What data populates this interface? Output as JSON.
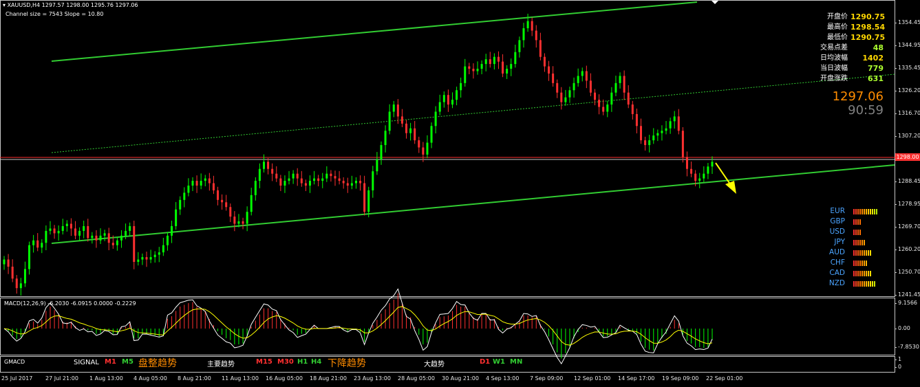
{
  "header": {
    "symbol_line": "XAUUSD,H4  1297.57 1298.00 1295.76 1297.06",
    "channel_line": "Channel size = 7543 Slope = 10.80"
  },
  "stats": [
    {
      "label": "开盘价",
      "value": "1290.75",
      "tone": "gold"
    },
    {
      "label": "最高价",
      "value": "1298.54",
      "tone": "gold"
    },
    {
      "label": "最低价",
      "value": "1290.75",
      "tone": "gold"
    },
    {
      "label": "交易点差",
      "value": "48",
      "tone": "green"
    },
    {
      "label": "日均波幅",
      "value": "1402",
      "tone": "gold"
    },
    {
      "label": "当日波幅",
      "value": "779",
      "tone": "green"
    },
    {
      "label": "开盘涨跌",
      "value": "631",
      "tone": "green"
    }
  ],
  "big_price": "1297.06",
  "big_timer": "90:59",
  "current_price_tag": "1298.00",
  "currency_strength": [
    {
      "name": "EUR",
      "bars": 12
    },
    {
      "name": "GBP",
      "bars": 4
    },
    {
      "name": "USD",
      "bars": 4
    },
    {
      "name": "JPY",
      "bars": 6
    },
    {
      "name": "AUD",
      "bars": 9
    },
    {
      "name": "CHF",
      "bars": 7
    },
    {
      "name": "CAD",
      "bars": 9
    },
    {
      "name": "NZD",
      "bars": 11
    }
  ],
  "price_scale": [
    "1354.45",
    "1344.95",
    "1335.45",
    "1326.20",
    "1316.70",
    "1307.20",
    "1297.70",
    "1288.45",
    "1278.95",
    "1269.70",
    "1260.20",
    "1250.70",
    "1241.45"
  ],
  "macd": {
    "label": "MACD(12,26,9) -6.2030 -6.0915 0.0000 -0.2229",
    "scale": [
      "9.1566",
      "0.00",
      "-7.8530"
    ]
  },
  "gmacd": {
    "label": "GMACD",
    "scale": [
      "1",
      "0"
    ],
    "signal_label": "SIGNAL",
    "signals": [
      {
        "text": "M1",
        "tone": "red"
      },
      {
        "text": "M5",
        "tone": "green"
      },
      {
        "text": "盘整趋势",
        "tone": "orange"
      },
      {
        "text": "主要趋势",
        "tone": "white"
      },
      {
        "text": "M15",
        "tone": "red"
      },
      {
        "text": "M30",
        "tone": "red"
      },
      {
        "text": "H1",
        "tone": "green"
      },
      {
        "text": "H4",
        "tone": "green"
      },
      {
        "text": "下降趋势",
        "tone": "orange"
      },
      {
        "text": "大趋势",
        "tone": "white"
      },
      {
        "text": "D1",
        "tone": "red"
      },
      {
        "text": "W1",
        "tone": "green"
      },
      {
        "text": "MN",
        "tone": "green"
      }
    ]
  },
  "time_axis": [
    "25 Jul 2017",
    "27 Jul 21:00",
    "1 Aug 13:00",
    "4 Aug 05:00",
    "8 Aug 21:00",
    "11 Aug 13:00",
    "16 Aug 05:00",
    "18 Aug 21:00",
    "23 Aug 13:00",
    "28 Aug 05:00",
    "30 Aug 21:00",
    "4 Sep 13:00",
    "7 Sep 09:00",
    "12 Sep 01:00",
    "14 Sep 17:00",
    "19 Sep 09:00",
    "22 Sep 01:00"
  ],
  "colors": {
    "bull": "#00ff00",
    "bear": "#ff3030",
    "channel": "#32cd32",
    "bid_line": "#ff3030",
    "arrow": "#ffff00"
  },
  "chart_data": {
    "type": "candlestick",
    "ylim": [
      1241.45,
      1358.5
    ],
    "closes": [
      1256,
      1253,
      1248,
      1244,
      1246,
      1252,
      1262,
      1264,
      1261,
      1263,
      1268,
      1269,
      1267,
      1268,
      1270,
      1271,
      1269,
      1266,
      1268,
      1270,
      1265,
      1266,
      1264,
      1266,
      1267,
      1263,
      1262,
      1264,
      1266,
      1268,
      1270,
      1255,
      1256,
      1257,
      1256,
      1257,
      1258,
      1259,
      1262,
      1266,
      1270,
      1277,
      1281,
      1284,
      1287,
      1289,
      1287,
      1289,
      1290,
      1288,
      1285,
      1281,
      1280,
      1278,
      1274,
      1271,
      1272,
      1271,
      1276,
      1283,
      1289,
      1294,
      1297,
      1294,
      1292,
      1290,
      1287,
      1289,
      1290,
      1292,
      1290,
      1288,
      1287,
      1289,
      1290,
      1289,
      1290,
      1292,
      1291,
      1290,
      1289,
      1288,
      1287,
      1288,
      1289,
      1288,
      1276,
      1285,
      1293,
      1298,
      1304,
      1310,
      1318,
      1321,
      1316,
      1313,
      1309,
      1311,
      1306,
      1303,
      1300,
      1305,
      1312,
      1318,
      1322,
      1325,
      1321,
      1323,
      1327,
      1330,
      1337,
      1336,
      1335,
      1336,
      1338,
      1340,
      1338,
      1341,
      1339,
      1334,
      1336,
      1338,
      1343,
      1348,
      1353,
      1356,
      1352,
      1348,
      1341,
      1337,
      1334,
      1330,
      1326,
      1322,
      1324,
      1327,
      1330,
      1333,
      1335,
      1331,
      1326,
      1323,
      1320,
      1318,
      1321,
      1326,
      1330,
      1333,
      1326,
      1321,
      1317,
      1312,
      1306,
      1304,
      1306,
      1308,
      1309,
      1310,
      1311,
      1314,
      1316,
      1310,
      1299,
      1294,
      1292,
      1289,
      1290,
      1292,
      1295,
      1297
    ]
  }
}
